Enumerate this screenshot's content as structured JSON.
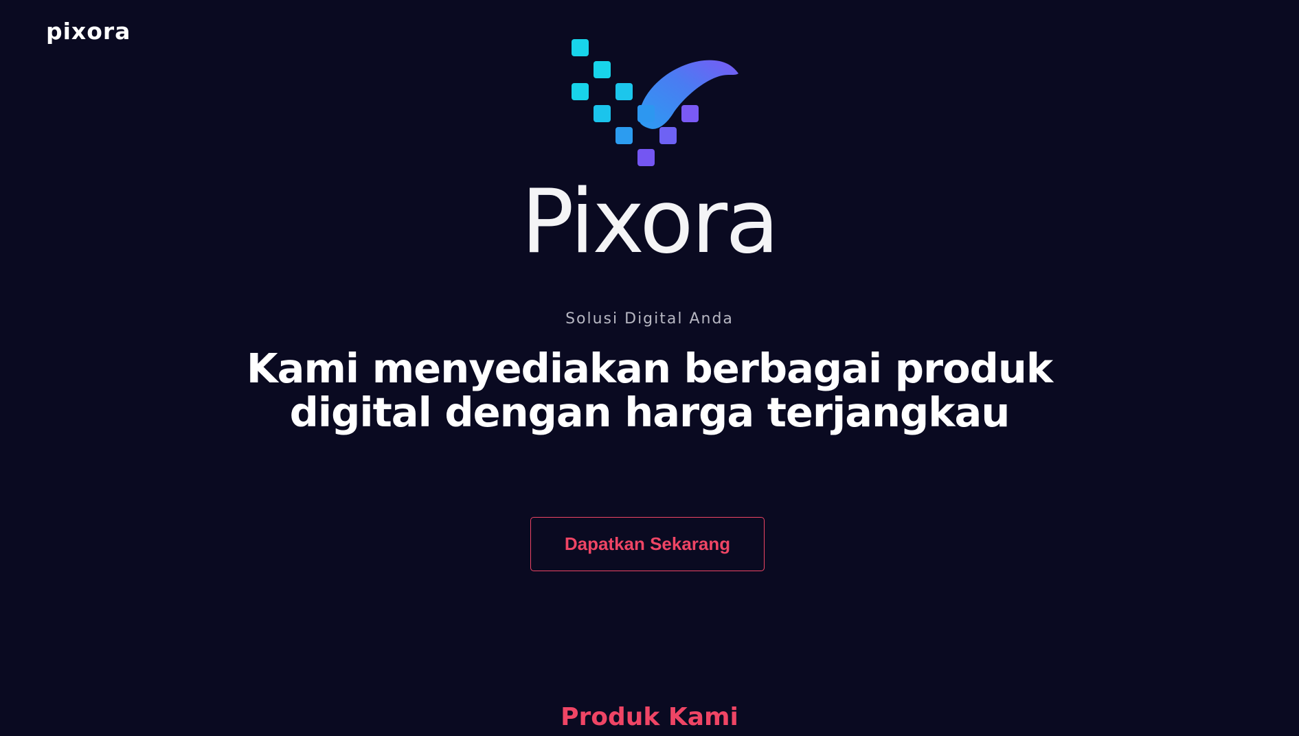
{
  "nav": {
    "brand": "pixora"
  },
  "hero": {
    "logo": {
      "wordmark": "Pixora",
      "icon": "pixel-swoosh-logo-icon",
      "colors": {
        "cyan": "#18d4ea",
        "blue": "#3b8cf0",
        "purple": "#7a5af5"
      }
    },
    "tagline": "Solusi Digital Anda",
    "headline": "Kami menyediakan berbagai produk digital dengan harga terjangkau",
    "cta_label": "Dapatkan Sekarang"
  },
  "products": {
    "title": "Produk Kami"
  },
  "colors": {
    "background": "#0a0a21",
    "accent": "#ef4565",
    "text": "#ffffff",
    "muted": "#b7b7c2"
  }
}
